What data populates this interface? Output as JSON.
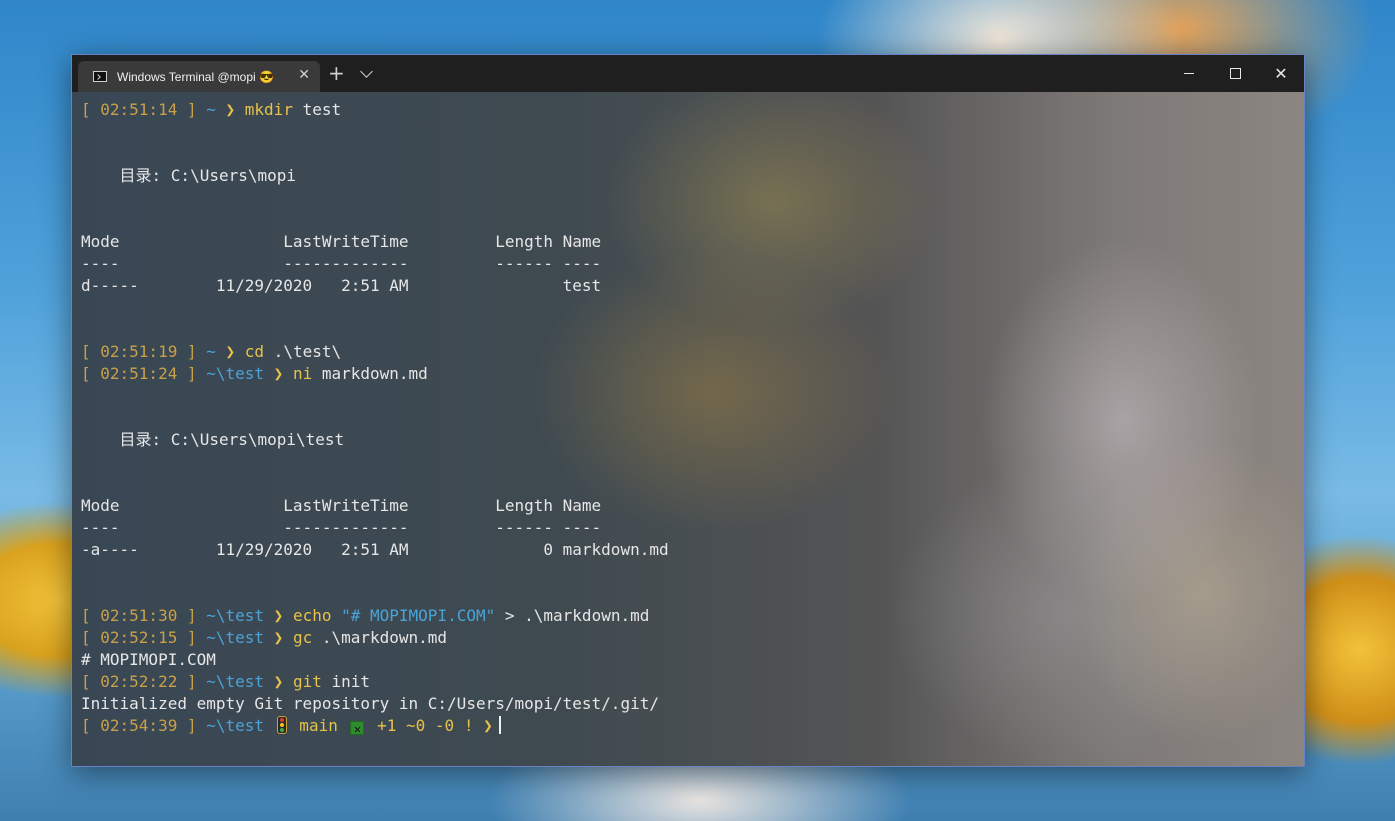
{
  "window": {
    "tab_title": "Windows Terminal @mopi 😎",
    "tab_close_symbol": "✕",
    "new_tab_symbol": "+",
    "close_symbol": "✕"
  },
  "colors": {
    "prompt_bracket": "#c9a04a",
    "path": "#4aa3d8",
    "command": "#e8c14a",
    "text": "#e6e6e6",
    "git_status": "#8bc34a"
  },
  "terminal": {
    "lines": [
      {
        "type": "prompt",
        "time": "02:51:14",
        "path": "~",
        "cmd": "mkdir",
        "args": "test"
      },
      {
        "type": "blank"
      },
      {
        "type": "blank"
      },
      {
        "type": "text",
        "text": "    目录: C:\\Users\\mopi"
      },
      {
        "type": "blank"
      },
      {
        "type": "blank"
      },
      {
        "type": "text",
        "text": "Mode                 LastWriteTime         Length Name"
      },
      {
        "type": "text",
        "text": "----                 -------------         ------ ----"
      },
      {
        "type": "text",
        "text": "d-----        11/29/2020   2:51 AM                test"
      },
      {
        "type": "blank"
      },
      {
        "type": "blank"
      },
      {
        "type": "prompt",
        "time": "02:51:19",
        "path": "~",
        "cmd": "cd",
        "args": ".\\test\\"
      },
      {
        "type": "prompt",
        "time": "02:51:24",
        "path": "~\\test",
        "cmd": "ni",
        "args": "markdown.md"
      },
      {
        "type": "blank"
      },
      {
        "type": "blank"
      },
      {
        "type": "text",
        "text": "    目录: C:\\Users\\mopi\\test"
      },
      {
        "type": "blank"
      },
      {
        "type": "blank"
      },
      {
        "type": "text",
        "text": "Mode                 LastWriteTime         Length Name"
      },
      {
        "type": "text",
        "text": "----                 -------------         ------ ----"
      },
      {
        "type": "text",
        "text": "-a----        11/29/2020   2:51 AM              0 markdown.md"
      },
      {
        "type": "blank"
      },
      {
        "type": "blank"
      },
      {
        "type": "prompt",
        "time": "02:51:30",
        "path": "~\\test",
        "cmd": "echo",
        "str": "\"# MOPIMOPI.COM\"",
        "args": "> .\\markdown.md"
      },
      {
        "type": "prompt",
        "time": "02:52:15",
        "path": "~\\test",
        "cmd": "gc",
        "args": ".\\markdown.md"
      },
      {
        "type": "text",
        "text": "# MOPIMOPI.COM"
      },
      {
        "type": "prompt",
        "time": "02:52:22",
        "path": "~\\test",
        "cmd": "git",
        "args": "init"
      },
      {
        "type": "text",
        "text": "Initialized empty Git repository in C:/Users/mopi/test/.git/"
      },
      {
        "type": "gitprompt",
        "time": "02:54:39",
        "path": "~\\test",
        "branch": "main",
        "xmark": "✕",
        "status": "+1 ~0 -0 !"
      }
    ]
  },
  "prompt_arrow": "❯"
}
